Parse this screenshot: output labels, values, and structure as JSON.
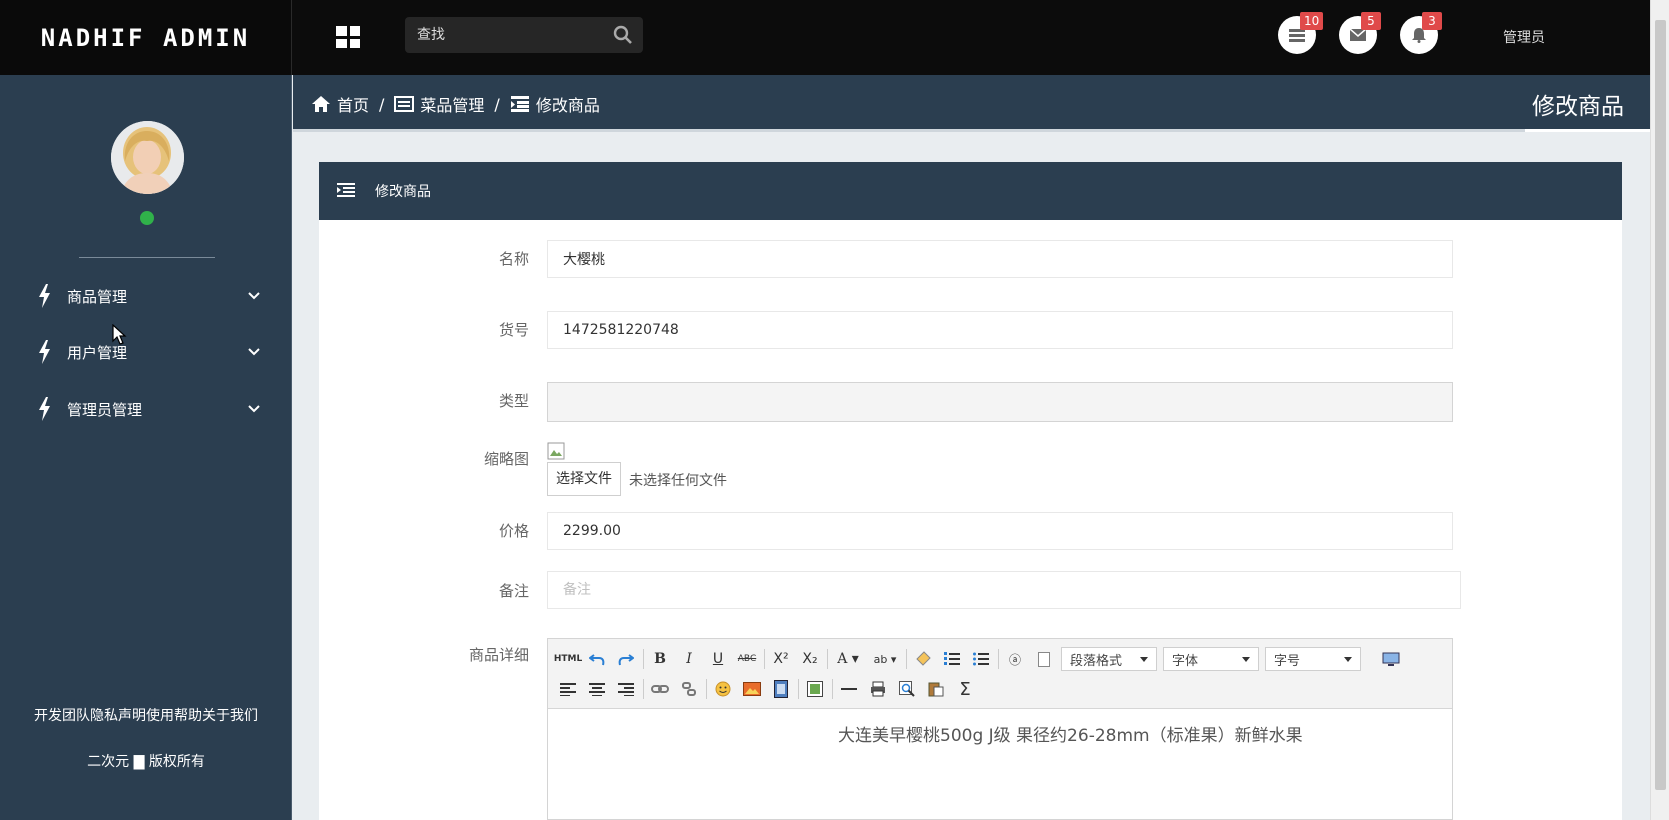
{
  "topbar": {
    "brand": "NADHIF ADMIN",
    "search_placeholder": "查找",
    "badges": [
      {
        "name": "tasks",
        "count": "10"
      },
      {
        "name": "messages",
        "count": "5"
      },
      {
        "name": "notifications",
        "count": "3"
      }
    ],
    "user": "管理员"
  },
  "sidebar": {
    "items": [
      {
        "label": "商品管理"
      },
      {
        "label": "用户管理"
      },
      {
        "label": "管理员管理"
      }
    ],
    "footer_links": "开发团队隐私声明使用帮助关于我们",
    "copyright": "二次元 ▇ 版权所有"
  },
  "breadcrumb": {
    "home": "首页",
    "section": "菜品管理",
    "current": "修改商品",
    "page_title": "修改商品"
  },
  "panel": {
    "title": "修改商品",
    "fields": {
      "name": {
        "label": "名称",
        "value": "大樱桃"
      },
      "code": {
        "label": "货号",
        "value": "1472581220748"
      },
      "type": {
        "label": "类型",
        "value": ""
      },
      "thumb": {
        "label": "缩略图",
        "button": "选择文件",
        "status": "未选择任何文件"
      },
      "price": {
        "label": "价格",
        "value": "2299.00"
      },
      "note": {
        "label": "备注",
        "placeholder": "备注"
      },
      "detail": {
        "label": "商品详细"
      }
    },
    "editor": {
      "selects": {
        "paragraph": "段落格式",
        "font": "字体",
        "size": "字号"
      },
      "content": "大连美早樱桃500g J级 果径约26-28mm（标准果）新鲜水果"
    }
  },
  "colors": {
    "sidebar_bg": "#2b3e50",
    "topbar_bg": "#0c0c0c",
    "badge_red": "#e04a4a",
    "online_green": "#30b14a"
  }
}
